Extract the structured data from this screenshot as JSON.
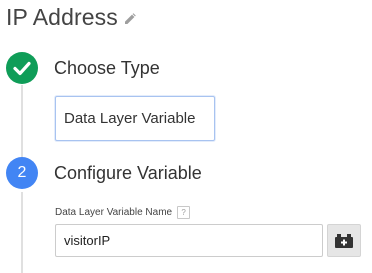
{
  "header": {
    "title": "IP Address",
    "edit_icon": "pencil-icon"
  },
  "steps": [
    {
      "number": "",
      "status": "complete",
      "icon": "checkmark-icon",
      "title": "Choose Type",
      "color": "#0f9d58"
    },
    {
      "number": "2",
      "status": "active",
      "title": "Configure Variable",
      "color": "#4285f4"
    }
  ],
  "variable_type": {
    "label": "Data Layer Variable"
  },
  "field": {
    "label": "Data Layer Variable Name",
    "help_icon": "?",
    "value": "visitorIP",
    "variable_button_icon": "variable-picker-icon"
  }
}
